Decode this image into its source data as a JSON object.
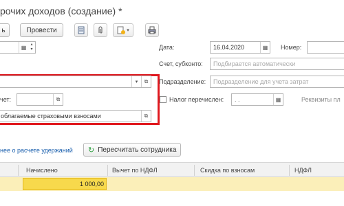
{
  "title": "рочих доходов (создание) *",
  "toolbar": {
    "write_label": "ь",
    "post_label": "Провести"
  },
  "form": {
    "date_label": "Дата:",
    "date_value": "16.04.2020",
    "number_label": "Номер:",
    "account_label": "Счет, субконто:",
    "account_placeholder": "Подбирается автоматически",
    "department_label": "Подразделение:",
    "department_placeholder": "Подразделение для учета затрат",
    "deduction_label": "чет:",
    "tax_transfer_label": "Налог перечислен:",
    "tax_transfer_value": ". .",
    "payment_details_label": "Реквизиты пл",
    "insurance_value": "облагаемые страховыми взносами"
  },
  "actions": {
    "deductions_link": "нее о расчете удержаний",
    "recalc_label": "Пересчитать сотрудника"
  },
  "grid": {
    "columns": [
      "Начислено",
      "Вычет по НДФЛ",
      "Скидка по взносам",
      "НДФЛ"
    ],
    "rows": [
      {
        "accrued": "1 000,00"
      }
    ]
  },
  "colors": {
    "highlight_frame": "#e0191f",
    "row_highlight": "#fbefb9",
    "active_cell": "#f7d94c",
    "link": "#1a5fad"
  }
}
